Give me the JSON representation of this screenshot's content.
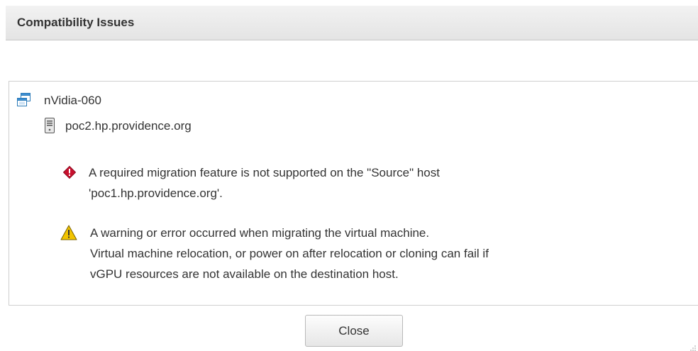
{
  "dialog": {
    "title": "Compatibility Issues"
  },
  "issues": {
    "vm": {
      "name": "nVidia-060",
      "icon": "virtual-machine-icon"
    },
    "host": {
      "name": "poc2.hp.providence.org",
      "icon": "host-server-icon"
    },
    "error": {
      "icon": "error-diamond-icon",
      "color": "#c8102e",
      "lines": [
        "A required migration feature is not supported on the \"Source\" host",
        "'poc1.hp.providence.org'."
      ]
    },
    "warning": {
      "icon": "warning-triangle-icon",
      "color": "#f2c400",
      "lines": [
        "A warning or error occurred when migrating the virtual machine.",
        "Virtual machine relocation, or power on after relocation or cloning can fail if",
        "vGPU resources are not available on the destination host."
      ]
    }
  },
  "footer": {
    "close_label": "Close"
  }
}
